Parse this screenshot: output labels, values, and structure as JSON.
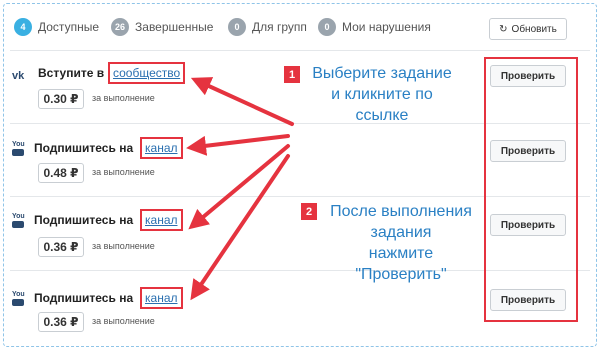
{
  "tabs": [
    {
      "count": "4",
      "label": "Доступные",
      "active": true
    },
    {
      "count": "26",
      "label": "Завершенные",
      "active": false
    },
    {
      "count": "0",
      "label": "Для групп",
      "active": false
    },
    {
      "count": "0",
      "label": "Мои нарушения",
      "active": false
    }
  ],
  "refresh_label": "Обновить",
  "tasks": [
    {
      "icon": "vk-icon",
      "icon_text": "vk",
      "action": "Вступите в",
      "link": "сообщество",
      "price": "0.30 ₽",
      "per": "за выполнение",
      "button": "Проверить"
    },
    {
      "icon": "youtube-icon",
      "icon_text": "You",
      "action": "Подпишитесь на",
      "link": "канал",
      "price": "0.48 ₽",
      "per": "за выполнение",
      "button": "Проверить"
    },
    {
      "icon": "youtube-icon",
      "icon_text": "You",
      "action": "Подпишитесь на",
      "link": "канал",
      "price": "0.36 ₽",
      "per": "за выполнение",
      "button": "Проверить"
    },
    {
      "icon": "youtube-icon",
      "icon_text": "You",
      "action": "Подпишитесь на",
      "link": "канал",
      "price": "0.36 ₽",
      "per": "за выполнение",
      "button": "Проверить"
    }
  ],
  "annotations": [
    {
      "step": "1",
      "lines": [
        "Выберите задание",
        "и кликните по",
        "ссылке"
      ]
    },
    {
      "step": "2",
      "lines": [
        "После выполнения",
        "задания",
        "нажмите",
        "\"Проверить\""
      ]
    }
  ],
  "colors": {
    "accent": "#3ab0e2",
    "annotation_red": "#e5333f",
    "annotation_text": "#2a80c4",
    "link": "#2a6fb0"
  }
}
